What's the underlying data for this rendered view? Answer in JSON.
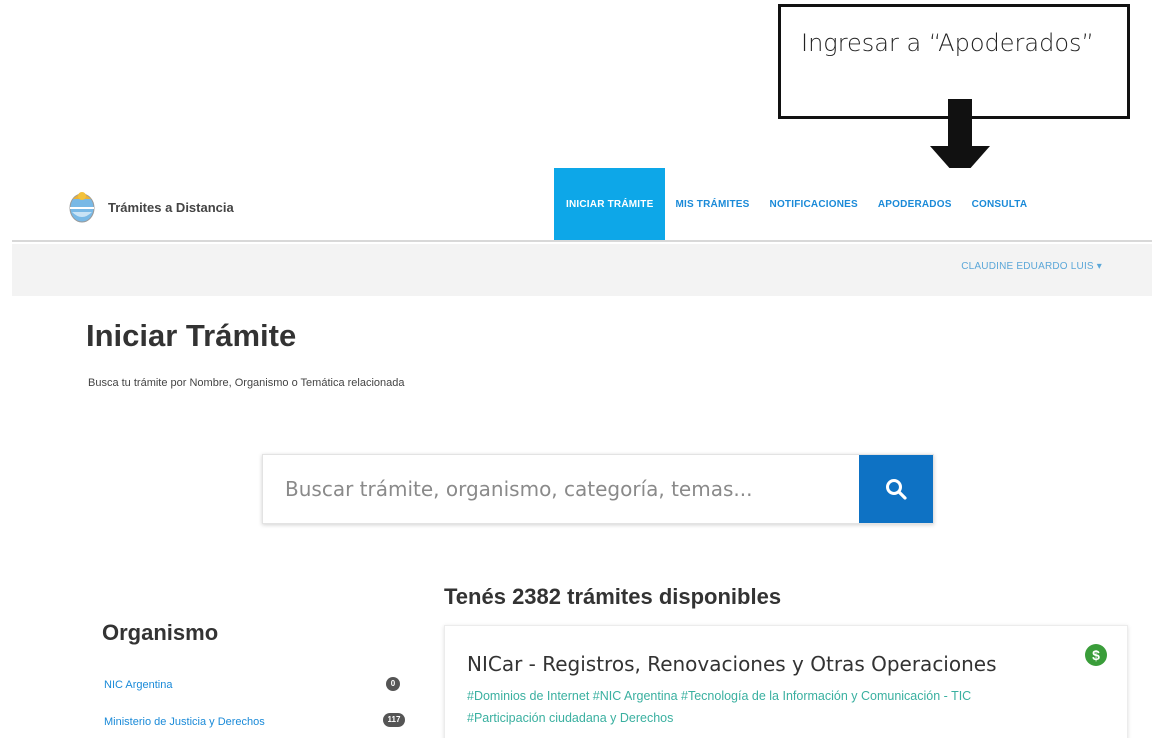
{
  "callout": {
    "text": "Ingresar a “Apoderados”"
  },
  "header": {
    "brand": "Trámites a Distancia",
    "nav": [
      {
        "label": "INICIAR TRÁMITE",
        "active": true
      },
      {
        "label": "MIS TRÁMITES",
        "active": false
      },
      {
        "label": "NOTIFICACIONES",
        "active": false
      },
      {
        "label": "APODERADOS",
        "active": false
      },
      {
        "label": "CONSULTA",
        "active": false
      }
    ],
    "user": "CLAUDINE EDUARDO LUIS ▾"
  },
  "page": {
    "title": "Iniciar Trámite",
    "subtitle": "Busca tu trámite por Nombre, Organismo o Temática relacionada"
  },
  "search": {
    "placeholder": "Buscar trámite, organismo, categoría, temas...",
    "icon": "search-icon"
  },
  "results": {
    "heading": "Tenés 2382 trámites disponibles"
  },
  "sidebar": {
    "title": "Organismo",
    "items": [
      {
        "label": "NIC Argentina",
        "count": "0"
      },
      {
        "label": "Ministerio de Justicia y Derechos",
        "count": "117"
      }
    ]
  },
  "card": {
    "title": "NICar - Registros, Renovaciones y Otras Operaciones",
    "tags": "#Dominios de Internet #NIC Argentina #Tecnología de la Información y Comunicación - TIC #Participación ciudadana y Derechos",
    "icon_label": "$",
    "icon_color": "#3a9d3a"
  },
  "colors": {
    "accent": "#0da7e8",
    "search_button": "#0e72c4",
    "link": "#1a8ad8",
    "tag": "#3ab0a0"
  }
}
